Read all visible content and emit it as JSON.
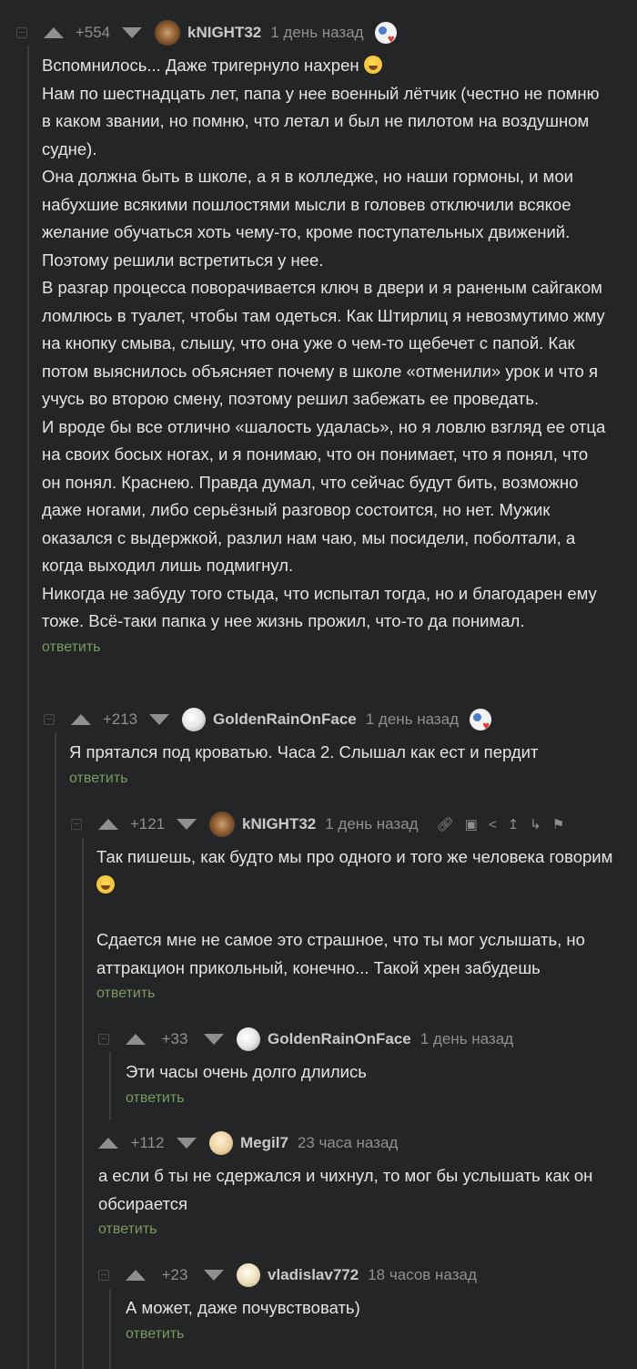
{
  "reply_label": "ответить",
  "comments": [
    {
      "id": "c1",
      "rating": "+554",
      "author": "kNIGHT32",
      "time": "1 день назад",
      "paragraphs": [
        "Вспомнилось... Даже тригернуло нахрен",
        "Нам по шестнадцать лет, папа у нее военный лётчик (честно не помню в каком звании, но помню, что летал и был не пилотом на воздушном судне).",
        "Она должна быть в школе, а я в колледже, но наши гормоны, и мои набухшие всякими пошлостями мысли в головев отключили всякое желание обучаться хоть чему-то, кроме поступательных движений. Поэтому решили встретиться у нее.",
        "В разгар процесса поворачивается ключ в двери и я раненым сайгаком ломлюсь в туалет, чтобы там одеться. Как Штирлиц я невозмутимо жму на кнопку смыва, слышу, что она уже о чем-то щебечет с папой. Как потом выяснилось объясняет почему в школе «отменили» урок и что я учусь во второю смену, поэтому решил забежать ее проведать.",
        "И вроде бы все отлично «шалость удалась», но я ловлю взгляд ее отца на своих босых ногах, и я понимаю, что он понимает, что я понял, что он понял. Краснею. Правда думал, что сейчас будут бить, возможно даже ногами, либо серьёзный разговор состоится, но нет. Мужик оказался с выдержкой, разлил нам чаю, мы посидели, поболтали, а когда выходил лишь подмигнул.",
        "Никогда не забуду того стыда, что испытал тогда, но и благодарен ему тоже. Всё-таки папка у нее жизнь прожил, что-то да понимал."
      ]
    },
    {
      "id": "c2",
      "rating": "+213",
      "author": "GoldenRainOnFace",
      "time": "1 день назад",
      "paragraphs": [
        "Я прятался под кроватью. Часа 2. Слышал как ест и пердит"
      ]
    },
    {
      "id": "c3",
      "rating": "+121",
      "author": "kNIGHT32",
      "time": "1 день назад",
      "paragraphs": [
        "Так пишешь, как будто мы про одного и того же человека говорим",
        "",
        "Сдается мне не самое это страшное, что ты мог услышать, но аттракцион прикольный, конечно... Такой хрен забудешь"
      ]
    },
    {
      "id": "c4",
      "rating": "+33",
      "author": "GoldenRainOnFace",
      "time": "1 день назад",
      "paragraphs": [
        "Эти часы очень долго длились"
      ]
    },
    {
      "id": "c5",
      "rating": "+112",
      "author": "Megil7",
      "time": "23 часа назад",
      "paragraphs": [
        "а если б ты не сдержался и чихнул, то мог бы услышать как он обсирается"
      ]
    },
    {
      "id": "c6",
      "rating": "+23",
      "author": "vladislav772",
      "time": "18 часов назад",
      "paragraphs": [
        "А может, даже почувствовать)"
      ]
    }
  ]
}
